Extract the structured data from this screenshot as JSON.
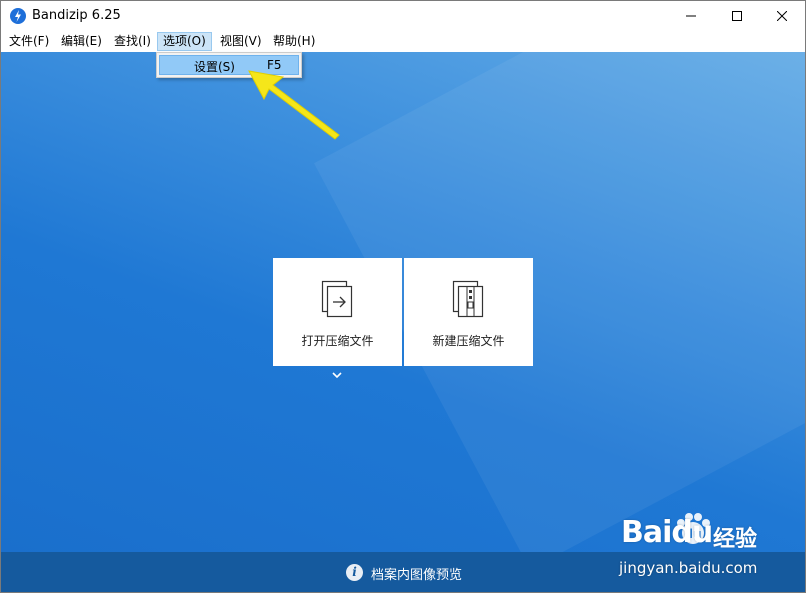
{
  "window": {
    "title": "Bandizip 6.25"
  },
  "menu": {
    "items": [
      {
        "label": "文件(F)"
      },
      {
        "label": "编辑(E)"
      },
      {
        "label": "查找(I)"
      },
      {
        "label": "选项(O)",
        "active": true
      },
      {
        "label": "视图(V)"
      },
      {
        "label": "帮助(H)"
      }
    ]
  },
  "dropdown": {
    "items": [
      {
        "label": "设置(S)",
        "shortcut": "F5"
      }
    ]
  },
  "main": {
    "open_label": "打开压缩文件",
    "new_label": "新建压缩文件"
  },
  "status": {
    "text": "档案内图像预览"
  },
  "watermark": {
    "brand": "Baidu",
    "suffix": "经验",
    "url": "jingyan.baidu.com"
  },
  "icons": {
    "app": "bandizip-logo-icon",
    "minimize": "minimize-icon",
    "maximize": "maximize-icon",
    "close": "close-icon",
    "open_archive": "open-archive-icon",
    "new_archive": "new-archive-icon",
    "expand": "chevron-down-icon",
    "info": "info-icon",
    "annotation": "arrow-annotation-icon"
  },
  "colors": {
    "accent": "#1e6fd9",
    "status_bar": "#155a9e",
    "menu_highlight": "#cce4f7",
    "dropdown_highlight": "#91c9f7",
    "annotation": "#f5e61a"
  }
}
